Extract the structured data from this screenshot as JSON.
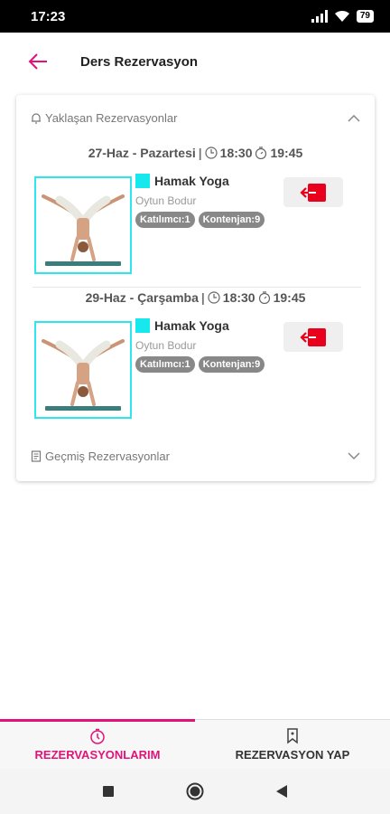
{
  "status_bar": {
    "time": "17:23",
    "battery": "79"
  },
  "app_bar": {
    "title": "Ders Rezervasyon"
  },
  "upcoming": {
    "label": "Yaklaşan Rezervasyonlar",
    "items": [
      {
        "date": "27-Haz - Pazartesi",
        "separator": "|",
        "start": "18:30",
        "end": "19:45",
        "class_name": "Hamak Yoga",
        "trainer": "Oytun Bodur",
        "participants": "Katılımcı:1",
        "quota": "Kontenjan:9"
      },
      {
        "date": "29-Haz - Çarşamba",
        "separator": "|",
        "start": "18:30",
        "end": "19:45",
        "class_name": "Hamak Yoga",
        "trainer": "Oytun Bodur",
        "participants": "Katılımcı:1",
        "quota": "Kontenjan:9"
      }
    ]
  },
  "past": {
    "label": "Geçmiş Rezervasyonlar"
  },
  "bottom_nav": {
    "tabs": [
      {
        "label": "REZERVASYONLARIM",
        "icon": "stopwatch-icon",
        "active": true
      },
      {
        "label": "REZERVASYON YAP",
        "icon": "bookmark-icon",
        "active": false
      }
    ]
  },
  "colors": {
    "accent": "#e0137a",
    "class_color": "#16e8ee",
    "thumb_border": "#2ee6f0",
    "cancel_red": "#e8001c"
  }
}
